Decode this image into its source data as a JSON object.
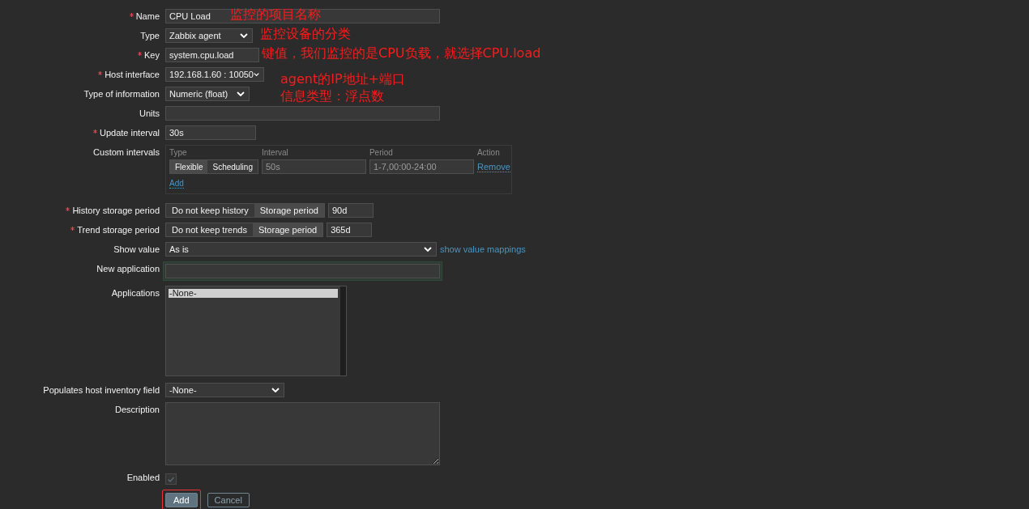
{
  "form": {
    "rows": [
      {
        "kind": "text",
        "label": "Name",
        "required": true,
        "value": "CPU Load"
      },
      {
        "kind": "select",
        "label": "Type",
        "required": false,
        "value": "Zabbix agent"
      },
      {
        "kind": "key",
        "label": "Key",
        "required": true,
        "value": "system.cpu.load"
      },
      {
        "kind": "select",
        "label": "Host interface",
        "required": true,
        "value": "192.168.1.60 : 10050"
      },
      {
        "kind": "select",
        "label": "Type of information",
        "required": false,
        "value": "Numeric (float)"
      },
      {
        "kind": "text",
        "label": "Units",
        "required": false,
        "value": ""
      },
      {
        "kind": "text",
        "label": "Update interval",
        "required": true,
        "value": "30s"
      },
      {
        "kind": "intervals",
        "label": "Custom intervals",
        "required": false,
        "columns": [
          "Type",
          "Interval",
          "Period",
          "Action"
        ],
        "types": [
          {
            "label": "Flexible",
            "selected": true
          },
          {
            "label": "Scheduling",
            "selected": false
          }
        ],
        "interval_placeholder": "50s",
        "period_placeholder": "1-7,00:00-24:00",
        "remove": "Remove",
        "add": "Add"
      },
      {
        "kind": "storage",
        "label": "History storage period",
        "required": true,
        "options": [
          {
            "label": "Do not keep history",
            "selected": false
          },
          {
            "label": "Storage period",
            "selected": true
          }
        ],
        "value": "90d"
      },
      {
        "kind": "storage",
        "label": "Trend storage period",
        "required": true,
        "options": [
          {
            "label": "Do not keep trends",
            "selected": false
          },
          {
            "label": "Storage period",
            "selected": true
          }
        ],
        "value": "365d"
      },
      {
        "kind": "select",
        "label": "Show value",
        "required": false,
        "value": "As is",
        "link": "show value mappings"
      },
      {
        "kind": "text",
        "label": "New application",
        "required": false,
        "value": "",
        "focused": true
      },
      {
        "kind": "list",
        "label": "Applications",
        "required": false,
        "options": [
          {
            "label": "-None-",
            "selected": true
          }
        ]
      },
      {
        "kind": "select",
        "label": "Populates host inventory field",
        "required": false,
        "value": "-None-"
      },
      {
        "kind": "textarea",
        "label": "Description",
        "required": false,
        "value": ""
      },
      {
        "kind": "checkbox",
        "label": "Enabled",
        "required": false,
        "checked": true
      }
    ],
    "buttons": [
      {
        "label": "Add",
        "kind": "primary",
        "highlighted": true
      },
      {
        "label": "Cancel",
        "kind": "secondary",
        "highlighted": false
      }
    ]
  },
  "annotations": [
    {
      "text": "监控的项目名称"
    },
    {
      "text": "监控设备的分类"
    },
    {
      "text": "键值，我们监控的是CPU负载，就选择CPU.load"
    },
    {
      "text": "agent的IP地址+端口"
    },
    {
      "text": "信息类型：浮点数"
    }
  ]
}
